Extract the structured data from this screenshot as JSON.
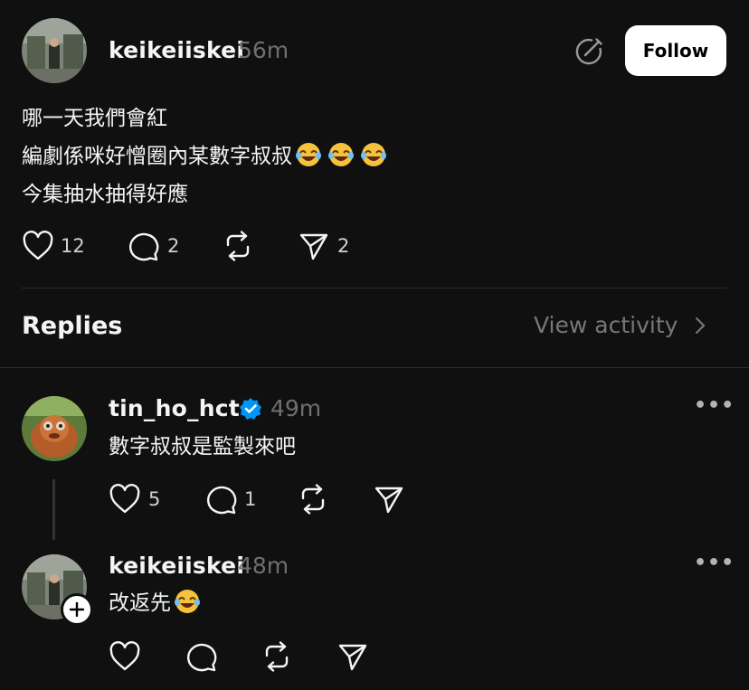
{
  "post": {
    "username": "keikeiiskei",
    "time": "56m",
    "follow_label": "Follow",
    "lines": [
      "哪一天我們會紅",
      "編劇係咪好憎圈內某數字叔叔",
      "今集抽水抽得好應"
    ],
    "likes": "12",
    "comments": "2",
    "shares": "2"
  },
  "replies_section": {
    "title": "Replies",
    "view_activity": "View activity"
  },
  "replies": [
    {
      "username": "tin_ho_hct",
      "verified": true,
      "time": "49m",
      "text": "數字叔叔是監製來吧",
      "likes": "5",
      "comments": "1"
    },
    {
      "username": "keikeiiskei",
      "time": "48m",
      "text": "改返先"
    }
  ],
  "colors": {
    "background": "#101010",
    "verified": "#0095f6",
    "muted": "#6f6f6f"
  }
}
